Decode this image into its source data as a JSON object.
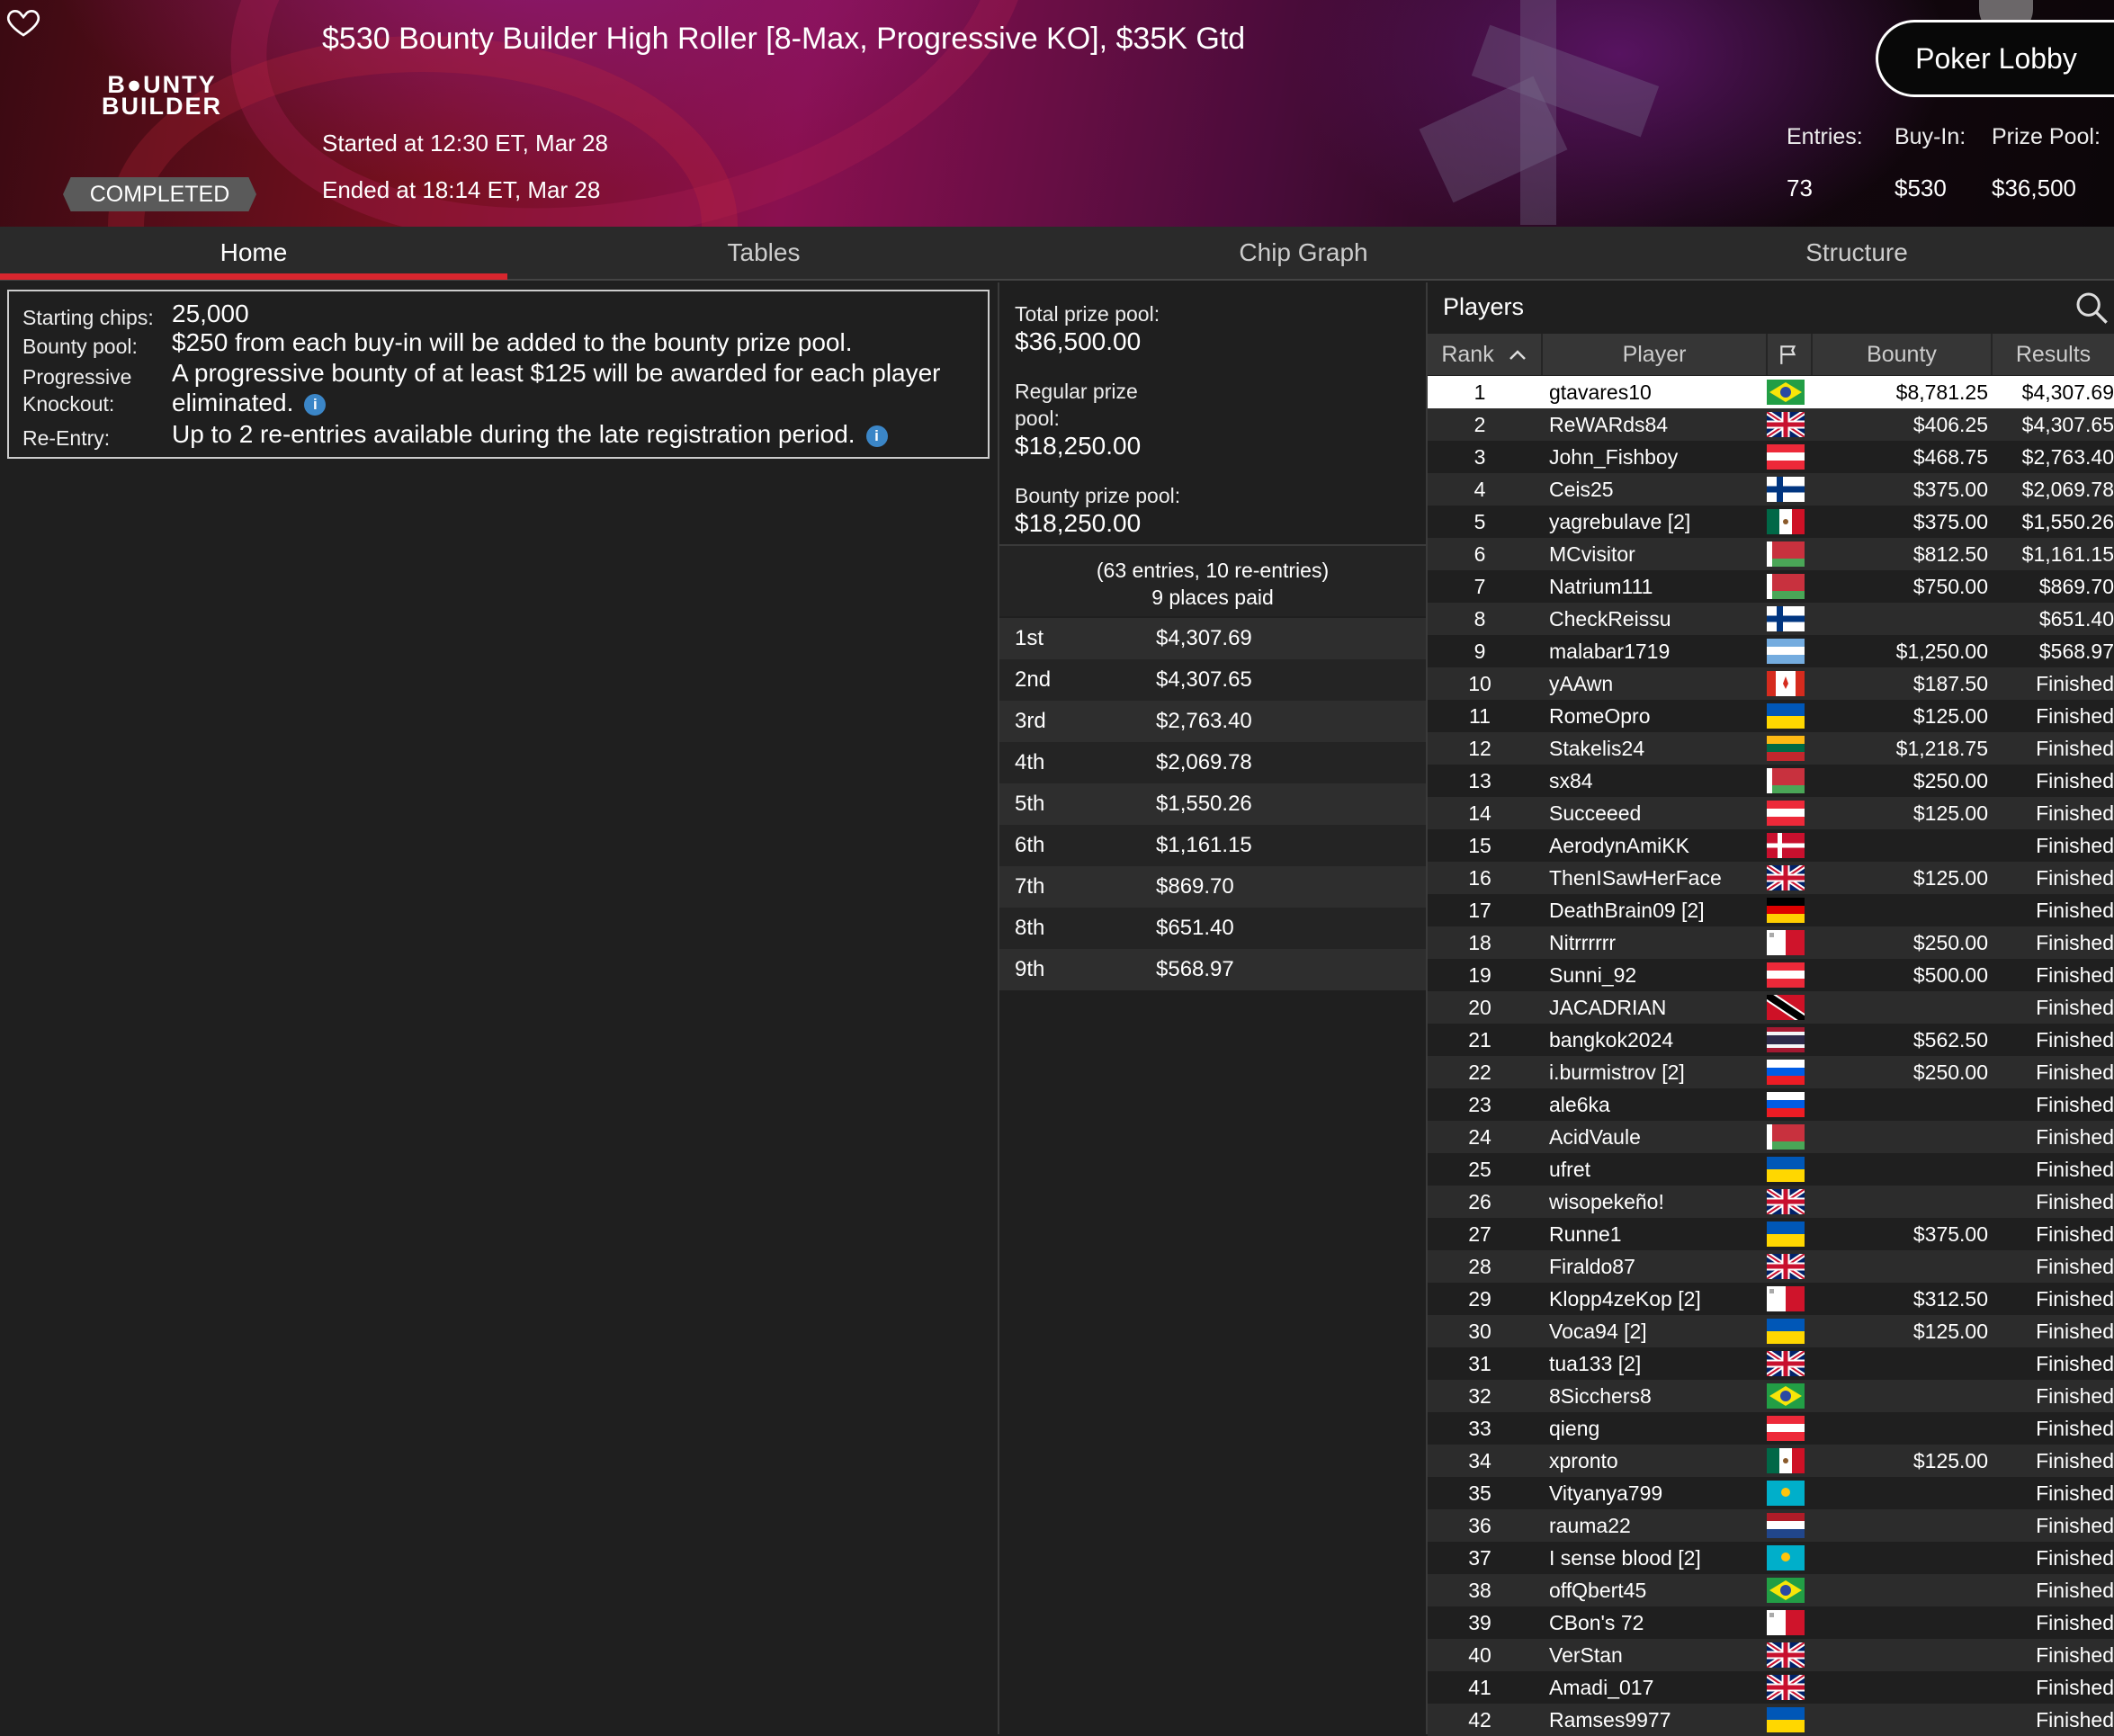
{
  "header": {
    "title": "$530 Bounty Builder High Roller [8-Max, Progressive KO], $35K Gtd",
    "logo_line1": "B●UNTY",
    "logo_line2": "BUILDER",
    "status": "COMPLETED",
    "started": "Started at 12:30 ET, Mar 28",
    "ended": "Ended at 18:14 ET, Mar 28",
    "lobby_button": "Poker Lobby",
    "entries_label": "Entries:",
    "entries": "73",
    "buyin_label": "Buy-In:",
    "buyin": "$530",
    "prizepool_label": "Prize Pool:",
    "prizepool": "$36,500",
    "favorite_icon": "heart-icon"
  },
  "tabs": [
    "Home",
    "Tables",
    "Chip Graph",
    "Structure"
  ],
  "info": {
    "starting_chips_label": "Starting chips:",
    "starting_chips": "25,000",
    "bounty_pool_label": "Bounty pool:",
    "bounty_pool": "$250 from each buy-in will be added to the bounty prize pool.",
    "pko_label_1": "Progressive",
    "pko_label_2": "Knockout:",
    "pko_line1": "A progressive bounty of at least $125 will be awarded for each player",
    "pko_line2": "eliminated.",
    "reentry_label": "Re-Entry:",
    "reentry": "Up to 2 re-entries available during the late registration period.",
    "info_icon_glyph": "i"
  },
  "prize": {
    "total_label": "Total prize pool:",
    "total": "$36,500.00",
    "regular_label_1": "Regular prize",
    "regular_label_2": "pool:",
    "regular": "$18,250.00",
    "bounty_label": "Bounty prize pool:",
    "bounty": "$18,250.00",
    "entries_note": "(63 entries, 10 re-entries)",
    "places_paid": "9 places paid",
    "payouts": [
      {
        "place": "1st",
        "amount": "$4,307.69"
      },
      {
        "place": "2nd",
        "amount": "$4,307.65"
      },
      {
        "place": "3rd",
        "amount": "$2,763.40"
      },
      {
        "place": "4th",
        "amount": "$2,069.78"
      },
      {
        "place": "5th",
        "amount": "$1,550.26"
      },
      {
        "place": "6th",
        "amount": "$1,161.15"
      },
      {
        "place": "7th",
        "amount": "$869.70"
      },
      {
        "place": "8th",
        "amount": "$651.40"
      },
      {
        "place": "9th",
        "amount": "$568.97"
      }
    ]
  },
  "players": {
    "title": "Players",
    "search_icon": "search-icon",
    "columns": {
      "rank": "Rank",
      "player": "Player",
      "flag_icon": "flag-icon",
      "bounty": "Bounty",
      "results": "Results"
    },
    "sort_icon": "chevron-up-icon",
    "rows": [
      {
        "rank": "1",
        "name": "gtavares10",
        "flag": "BR",
        "bounty": "$8,781.25",
        "result": "$4,307.69"
      },
      {
        "rank": "2",
        "name": "ReWARds84",
        "flag": "GB",
        "bounty": "$406.25",
        "result": "$4,307.65"
      },
      {
        "rank": "3",
        "name": "John_Fishboy",
        "flag": "AT",
        "bounty": "$468.75",
        "result": "$2,763.40"
      },
      {
        "rank": "4",
        "name": "Ceis25",
        "flag": "FI",
        "bounty": "$375.00",
        "result": "$2,069.78"
      },
      {
        "rank": "5",
        "name": "yagrebulave [2]",
        "flag": "MX",
        "bounty": "$375.00",
        "result": "$1,550.26"
      },
      {
        "rank": "6",
        "name": "MCvisitor",
        "flag": "BY",
        "bounty": "$812.50",
        "result": "$1,161.15"
      },
      {
        "rank": "7",
        "name": "Natrium111",
        "flag": "BY",
        "bounty": "$750.00",
        "result": "$869.70"
      },
      {
        "rank": "8",
        "name": "CheckReissu",
        "flag": "FI",
        "bounty": "",
        "result": "$651.40"
      },
      {
        "rank": "9",
        "name": "malabar1719",
        "flag": "AR",
        "bounty": "$1,250.00",
        "result": "$568.97"
      },
      {
        "rank": "10",
        "name": "yAAwn",
        "flag": "CA",
        "bounty": "$187.50",
        "result": "Finished"
      },
      {
        "rank": "11",
        "name": "RomeOpro",
        "flag": "UA",
        "bounty": "$125.00",
        "result": "Finished"
      },
      {
        "rank": "12",
        "name": "Stakelis24",
        "flag": "LT",
        "bounty": "$1,218.75",
        "result": "Finished"
      },
      {
        "rank": "13",
        "name": "sx84",
        "flag": "BY",
        "bounty": "$250.00",
        "result": "Finished"
      },
      {
        "rank": "14",
        "name": "Succeeed",
        "flag": "AT",
        "bounty": "$125.00",
        "result": "Finished"
      },
      {
        "rank": "15",
        "name": "AerodynAmiKK",
        "flag": "DK",
        "bounty": "",
        "result": "Finished"
      },
      {
        "rank": "16",
        "name": "ThenISawHerFace",
        "flag": "GB",
        "bounty": "$125.00",
        "result": "Finished"
      },
      {
        "rank": "17",
        "name": "DeathBrain09 [2]",
        "flag": "DE",
        "bounty": "",
        "result": "Finished"
      },
      {
        "rank": "18",
        "name": "Nitrrrrrr",
        "flag": "MT",
        "bounty": "$250.00",
        "result": "Finished"
      },
      {
        "rank": "19",
        "name": "Sunni_92",
        "flag": "AT",
        "bounty": "$500.00",
        "result": "Finished"
      },
      {
        "rank": "20",
        "name": "JACADRIAN",
        "flag": "TT",
        "bounty": "",
        "result": "Finished"
      },
      {
        "rank": "21",
        "name": "bangkok2024",
        "flag": "TH",
        "bounty": "$562.50",
        "result": "Finished"
      },
      {
        "rank": "22",
        "name": "i.burmistrov [2]",
        "flag": "SI",
        "bounty": "$250.00",
        "result": "Finished"
      },
      {
        "rank": "23",
        "name": "ale6ka",
        "flag": "SI",
        "bounty": "",
        "result": "Finished"
      },
      {
        "rank": "24",
        "name": "AcidVaule",
        "flag": "BY",
        "bounty": "",
        "result": "Finished"
      },
      {
        "rank": "25",
        "name": "ufret",
        "flag": "UA",
        "bounty": "",
        "result": "Finished"
      },
      {
        "rank": "26",
        "name": "wisopekeño!",
        "flag": "GB",
        "bounty": "",
        "result": "Finished"
      },
      {
        "rank": "27",
        "name": "Runne1",
        "flag": "UA",
        "bounty": "$375.00",
        "result": "Finished"
      },
      {
        "rank": "28",
        "name": "Firaldo87",
        "flag": "GB",
        "bounty": "",
        "result": "Finished"
      },
      {
        "rank": "29",
        "name": "Klopp4zeKop [2]",
        "flag": "MT",
        "bounty": "$312.50",
        "result": "Finished"
      },
      {
        "rank": "30",
        "name": "Voca94 [2]",
        "flag": "UA",
        "bounty": "$125.00",
        "result": "Finished"
      },
      {
        "rank": "31",
        "name": "tua133 [2]",
        "flag": "GB",
        "bounty": "",
        "result": "Finished"
      },
      {
        "rank": "32",
        "name": "8Sicchers8",
        "flag": "BR",
        "bounty": "",
        "result": "Finished"
      },
      {
        "rank": "33",
        "name": "qieng",
        "flag": "AT",
        "bounty": "",
        "result": "Finished"
      },
      {
        "rank": "34",
        "name": "xpronto",
        "flag": "MX",
        "bounty": "$125.00",
        "result": "Finished"
      },
      {
        "rank": "35",
        "name": "Vityanya799",
        "flag": "KZ",
        "bounty": "",
        "result": "Finished"
      },
      {
        "rank": "36",
        "name": "rauma22",
        "flag": "NL",
        "bounty": "",
        "result": "Finished"
      },
      {
        "rank": "37",
        "name": "I sense blood [2]",
        "flag": "KZ",
        "bounty": "",
        "result": "Finished"
      },
      {
        "rank": "38",
        "name": "offQbert45",
        "flag": "BR",
        "bounty": "",
        "result": "Finished"
      },
      {
        "rank": "39",
        "name": "CBon's 72",
        "flag": "MT",
        "bounty": "",
        "result": "Finished"
      },
      {
        "rank": "40",
        "name": "VerStan",
        "flag": "GB",
        "bounty": "",
        "result": "Finished"
      },
      {
        "rank": "41",
        "name": "Amadi_017",
        "flag": "GB",
        "bounty": "",
        "result": "Finished"
      },
      {
        "rank": "42",
        "name": "Ramses9977",
        "flag": "UA",
        "bounty": "",
        "result": "Finished"
      }
    ]
  }
}
